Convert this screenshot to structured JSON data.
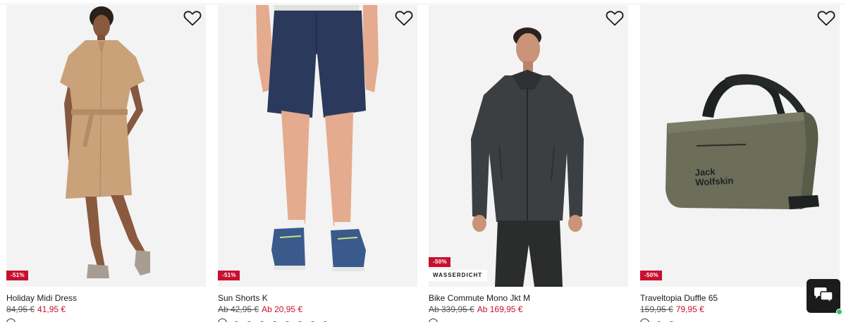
{
  "products": [
    {
      "name": "Holiday Midi Dress",
      "old_price": "84,95 €",
      "new_price": "41,95 €",
      "discount": "-51%",
      "tag": "",
      "image": "model-in-beige-shirt-dress"
    },
    {
      "name": "Sun Shorts K",
      "old_price": "Ab 42,95 €",
      "new_price": "Ab 20,95 €",
      "discount": "-51%",
      "tag": "",
      "image": "child-in-navy-shorts"
    },
    {
      "name": "Bike Commute Mono Jkt M",
      "old_price": "Ab 339,95 €",
      "new_price": "Ab 169,95 €",
      "discount": "-50%",
      "tag": "WASSERDICHT",
      "image": "man-in-dark-grey-shell-jacket"
    },
    {
      "name": "Traveltopia Duffle 65",
      "old_price": "159,95 €",
      "new_price": "79,95 €",
      "discount": "-50%",
      "tag": "",
      "image": "olive-duffle-bag",
      "logo_line1": "Jack",
      "logo_line2": "Wolfskin"
    }
  ],
  "icons": {
    "wishlist": "heart-outline-icon",
    "chat": "chat-bubbles-icon"
  },
  "colors": {
    "sale_red": "#c8102e",
    "online_green": "#36c36a",
    "chat_bg": "#1b1b1b"
  }
}
